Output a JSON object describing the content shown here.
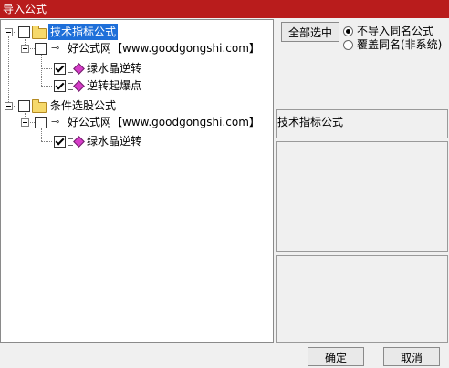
{
  "window": {
    "title": "导入公式"
  },
  "tree": {
    "root1": {
      "label": "技术指标公式"
    },
    "root1_child": {
      "label": "好公式网【www.goodgongshi.com】"
    },
    "root1_leaf1": {
      "label": "绿水晶逆转"
    },
    "root1_leaf2": {
      "label": "逆转起爆点"
    },
    "root2": {
      "label": "条件选股公式"
    },
    "root2_child": {
      "label": "好公式网【www.goodgongshi.com】"
    },
    "root2_leaf1": {
      "label": "绿水晶逆转"
    }
  },
  "options": {
    "select_all_label": "全部选中",
    "radio1_label": "不导入同名公式",
    "radio2_label": "覆盖同名(非系统)",
    "selected": "radio1"
  },
  "info": {
    "category_text": "技术指标公式"
  },
  "footer": {
    "ok_label": "确定",
    "cancel_label": "取消"
  },
  "colors": {
    "titlebar": "#b91c1c",
    "selection": "#1e6fd9"
  }
}
